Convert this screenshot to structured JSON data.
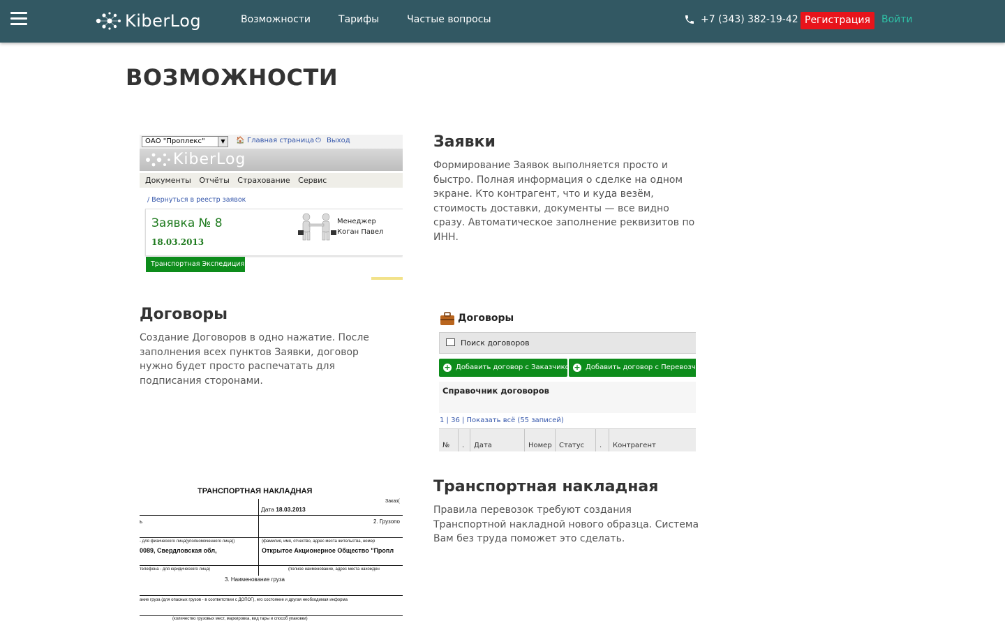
{
  "header": {
    "logo_text": "KiberLog",
    "nav": [
      "Возможности",
      "Тарифы",
      "Частые вопросы"
    ],
    "phone": "+7 (343) 382-19-42",
    "register_label": "Регистрация",
    "login_label": "Войти"
  },
  "page": {
    "title": "ВОЗМОЖНОСТИ"
  },
  "sections": [
    {
      "title": "Заявки",
      "text": "Формирование Заявок выполняется просто и быстро. Полная информация о сделке на одном экране. Кто контрагент, что и куда везём, стоимость доставки, документы — все видно сразу. Автоматическое заполнение реквизитов по ИНН."
    },
    {
      "title": "Договоры",
      "text": "Создание Договоров в одно нажатие. После заполнения всех пунктов Заявки, договор нужно будет просто распечатать для подписания сторонами."
    },
    {
      "title": "Транспортная накладная",
      "text": "Правила перевозок требуют создания Транспортной накладной нового образца. Система Вам без труда поможет это сделать."
    }
  ],
  "shot_orders": {
    "company": "ОАО \"Проплекс\"",
    "home_link": "Главная страница",
    "exit_link": "Выход",
    "logo_text": "KiberLog",
    "menu": [
      "Документы",
      "Отчёты",
      "Страхование",
      "Сервис"
    ],
    "back_link": "/ Вернуться в реестр заявок",
    "order_number": "Заявка № 8",
    "order_date": "18.03.2013",
    "manager_label": "Менеджер",
    "manager_name": "Коган Павел",
    "tab_label": "Транспортная Экспедиция"
  },
  "shot_contracts": {
    "title": "Договоры",
    "search_label": "Поиск договоров",
    "add_customer": "Добавить договор с Заказчиком",
    "add_carrier": "Добавить договор с Перевозчиком",
    "reference_title": "Справочник договоров",
    "pages": "1 |  36  |  Показать всё (55 записей)",
    "columns": [
      "№",
      ".",
      "Дата",
      "Номер",
      "Статус",
      ".",
      "Контрагент"
    ]
  },
  "shot_waybill": {
    "title": "ТРАНСПОРТНАЯ НАКЛАДНАЯ",
    "order_label": "Заказ(",
    "date_label": "Дата",
    "date_value": "18.03.2013",
    "cargo_sender": "2. Грузопо",
    "num_mark": "ь",
    "left_small": "- для физического лица(уполномоченного лица))",
    "right_small": "(фамилия, имя, отчество, адрес места жительства, номер",
    "left_bold": "0089, Свердловская обл,",
    "right_bold": "Открытое Акционерное Общество \"Пропл",
    "left_small2": "телефона - для юридического лица)",
    "right_small2": "(полное наименование, адрес места нахожден",
    "cargo_name": "3. Наименование груза",
    "cargo_small": "ание груза (для опасных грузов - в соответствии с ДОПОГ), его состояние и другая необходимая информа",
    "bottom_small": "(количество грузовых мест, маркировка, вид тары и способ упаковки)"
  }
}
